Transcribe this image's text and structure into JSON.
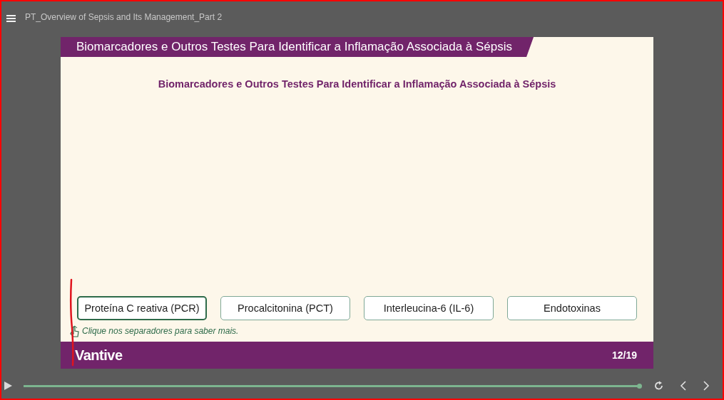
{
  "window": {
    "title": "PT_Overview of Sepsis and Its Management_Part 2"
  },
  "slide": {
    "header": "Biomarcadores e Outros Testes Para Identificar a Inflamação Associada à Sépsis",
    "heading": "Biomarcadores e Outros Testes Para Identificar a Inflamação Associada à Sépsis",
    "tabs": [
      {
        "label": "Proteína C reativa (PCR)",
        "selected": true
      },
      {
        "label": "Procalcitonina (PCT)",
        "selected": false
      },
      {
        "label": "Interleucina-6 (IL-6)",
        "selected": false
      },
      {
        "label": "Endotoxinas",
        "selected": false
      }
    ],
    "hint": "Clique nos separadores para saber mais.",
    "logo": "Vantive",
    "page": "12/19"
  },
  "player": {
    "progress": {
      "level": 1
    }
  }
}
